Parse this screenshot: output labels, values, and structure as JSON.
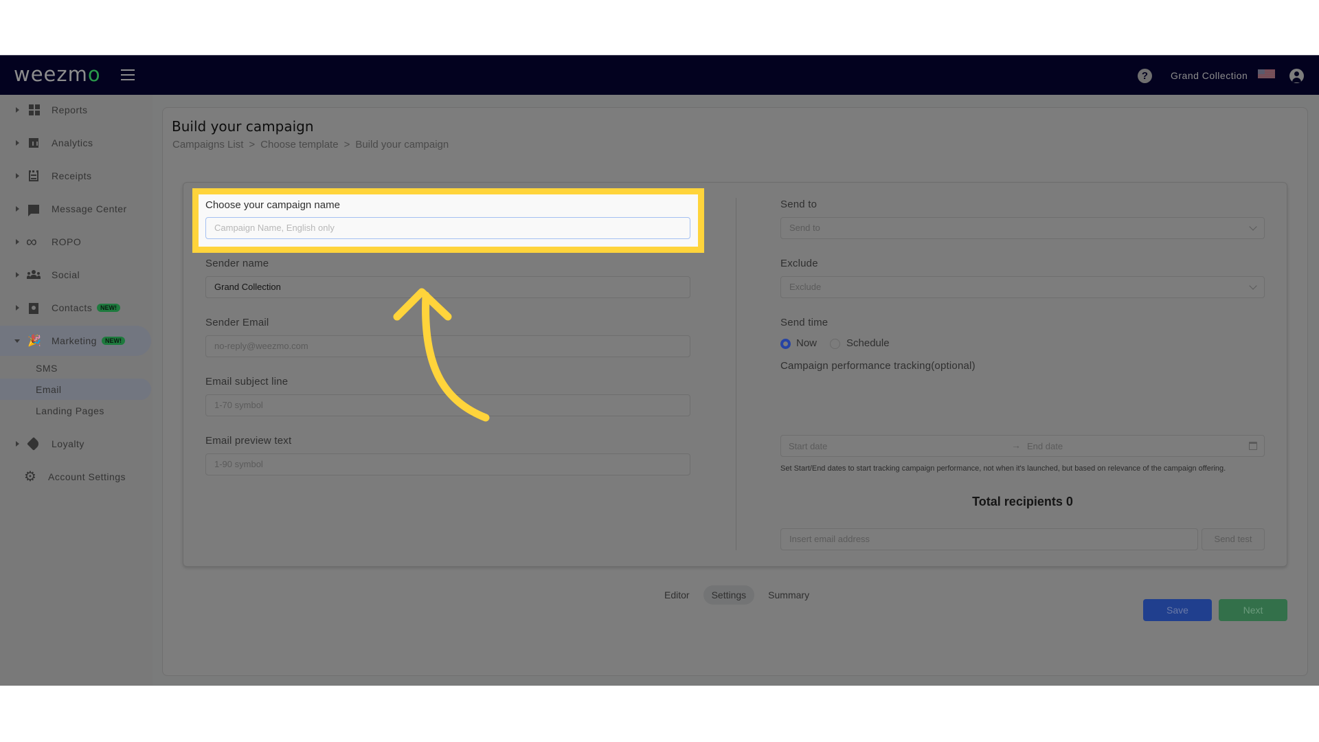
{
  "header": {
    "logo": "weezm",
    "logo_accent": "o",
    "account_name": "Grand Collection",
    "icons": {
      "menu": "hamburger-icon",
      "help": "question-circle-icon",
      "flag": "us-flag-icon",
      "user": "user-circle-icon"
    }
  },
  "sidebar": {
    "items": [
      {
        "label": "Reports",
        "icon": "dashboard-icon"
      },
      {
        "label": "Analytics",
        "icon": "bar-chart-icon"
      },
      {
        "label": "Receipts",
        "icon": "receipt-icon"
      },
      {
        "label": "Message Center",
        "icon": "chat-icon"
      },
      {
        "label": "ROPO",
        "icon": "infinity-icon"
      },
      {
        "label": "Social",
        "icon": "people-icon"
      },
      {
        "label": "Contacts",
        "icon": "contacts-icon",
        "badge": "NEW!"
      },
      {
        "label": "Marketing",
        "icon": "party-popper-icon",
        "badge": "NEW!",
        "expanded": true
      },
      {
        "label": "Loyalty",
        "icon": "tag-icon"
      },
      {
        "label": "Account Settings",
        "icon": "gear-icon"
      }
    ],
    "marketing_sub": [
      {
        "label": "SMS"
      },
      {
        "label": "Email",
        "active": true
      },
      {
        "label": "Landing Pages"
      }
    ]
  },
  "page": {
    "title": "Build your campaign",
    "breadcrumb": [
      "Campaigns List",
      ">",
      "Choose template",
      ">",
      "Build your campaign"
    ]
  },
  "form": {
    "campaign_name": {
      "label": "Choose your campaign name",
      "placeholder": "Campaign Name, English only",
      "value": ""
    },
    "sender_name": {
      "label": "Sender name",
      "value": "Grand Collection"
    },
    "sender_email": {
      "label": "Sender Email",
      "placeholder": "no-reply@weezmo.com"
    },
    "subject_line": {
      "label": "Email subject line",
      "placeholder": "1-70 symbol"
    },
    "preview_text": {
      "label": "Email preview text",
      "placeholder": "1-90 symbol"
    },
    "send_to": {
      "label": "Send to",
      "placeholder": "Send to"
    },
    "exclude": {
      "label": "Exclude",
      "placeholder": "Exclude"
    },
    "send_time": {
      "label": "Send time",
      "options": [
        "Now",
        "Schedule"
      ],
      "selected": "Now"
    },
    "tracking": {
      "label": "Campaign performance tracking(optional)",
      "start_placeholder": "Start date",
      "arrow": "→",
      "end_placeholder": "End date",
      "help": "Set Start/End dates to start tracking campaign performance, not when it's launched, but based on relevance of the campaign offering."
    },
    "total_recipients": "Total recipients 0",
    "test_email": {
      "placeholder": "Insert email address",
      "button": "Send test"
    }
  },
  "steps": {
    "tabs": [
      "Editor",
      "Settings",
      "Summary"
    ],
    "active": "Settings"
  },
  "actions": {
    "save": "Save",
    "next": "Next"
  },
  "colors": {
    "header_bg": "#03021f",
    "highlight": "#ffd43b",
    "save": "#203f8e",
    "next": "#33704a",
    "badge": "#1e7a3e",
    "radio_checked": "#2744a4"
  }
}
